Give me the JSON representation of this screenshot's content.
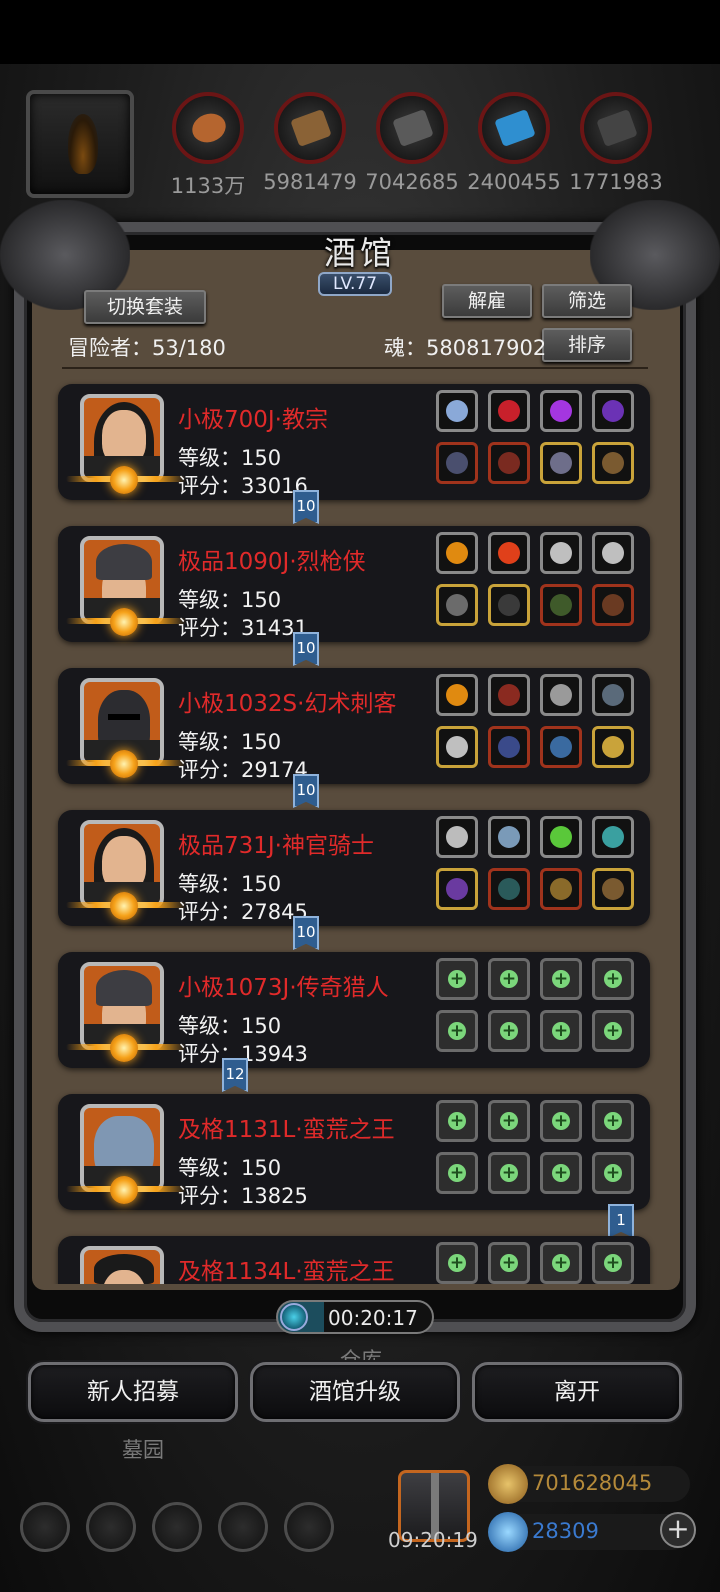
{
  "resources": [
    {
      "icon": "meat-icon",
      "value": "1133万",
      "color": "#b5652f"
    },
    {
      "icon": "wood-icon",
      "value": "5981479",
      "color": "#8a6236"
    },
    {
      "icon": "stone-icon",
      "value": "7042685",
      "color": "#5a5a5a"
    },
    {
      "icon": "crystal-icon",
      "value": "2400455",
      "color": "#2f8fd0"
    },
    {
      "icon": "iron-icon",
      "value": "1771983",
      "color": "#444"
    }
  ],
  "panel": {
    "title": "酒馆",
    "level": "LV.77",
    "switch_set": "切换套装",
    "dismiss": "解雇",
    "filter": "筛选",
    "sort": "排序",
    "adventurers": "冒险者：53/180",
    "soul": "魂：580817902"
  },
  "heroes": [
    {
      "name": "小极700J·教宗",
      "level": "等级：150",
      "score": "评分：33016",
      "portrait": "nun"
    },
    {
      "name": "极品1090J·烈枪侠",
      "level": "等级：150",
      "score": "评分：31431",
      "portrait": "helm"
    },
    {
      "name": "小极1032S·幻术刺客",
      "level": "等级：150",
      "score": "评分：29174",
      "portrait": "mask"
    },
    {
      "name": "极品731J·神官骑士",
      "level": "等级：150",
      "score": "评分：27845",
      "portrait": "nun"
    },
    {
      "name": "小极1073J·传奇猎人",
      "level": "等级：150",
      "score": "评分：13943",
      "portrait": "helm"
    },
    {
      "name": "及格1131L·蛮荒之王",
      "level": "等级：150",
      "score": "评分：13825",
      "portrait": "beast"
    },
    {
      "name": "及格1134L·蛮荒之王",
      "level": "",
      "score": "",
      "portrait": "man"
    }
  ],
  "flags": [
    "10",
    "10",
    "10",
    "10",
    "12",
    "1"
  ],
  "timer": "00:20:17",
  "buttons": {
    "recruit": "新人招募",
    "upgrade": "酒馆升级",
    "leave": "离开"
  },
  "background_labels": {
    "warehouse": "仓库",
    "cemetery": "墓园"
  },
  "bottom": {
    "clock": "09:20:19",
    "gold": "701628045",
    "gems": "28309",
    "plus": "+"
  }
}
